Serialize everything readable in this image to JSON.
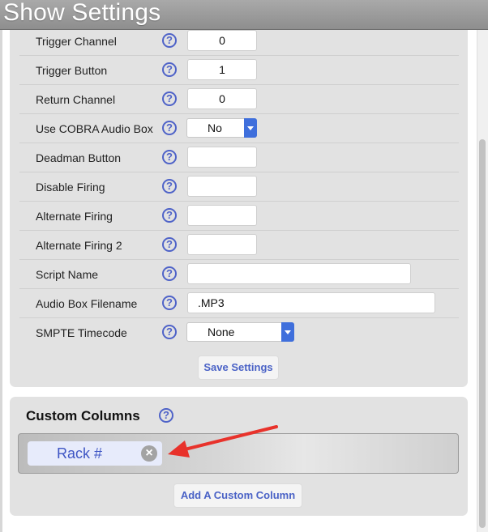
{
  "window": {
    "title": "Show Settings"
  },
  "settings": {
    "rows": [
      {
        "label": "Trigger Channel",
        "value": "0"
      },
      {
        "label": "Trigger Button",
        "value": "1"
      },
      {
        "label": "Return Channel",
        "value": "0"
      },
      {
        "label": "Use COBRA Audio Box",
        "value": "No"
      },
      {
        "label": "Deadman Button",
        "value": ""
      },
      {
        "label": "Disable Firing",
        "value": ""
      },
      {
        "label": "Alternate Firing",
        "value": ""
      },
      {
        "label": "Alternate Firing 2",
        "value": ""
      },
      {
        "label": "Script Name",
        "value": ""
      },
      {
        "label": "Audio Box Filename",
        "value": ".MP3"
      },
      {
        "label": "SMPTE Timecode",
        "value": "None"
      }
    ],
    "save_label": "Save Settings"
  },
  "custom_columns": {
    "title": "Custom Columns",
    "tags": [
      {
        "label": "Rack #"
      }
    ],
    "add_label": "Add A Custom Column"
  },
  "help_glyph": "?",
  "remove_glyph": "×",
  "colors": {
    "accent": "#4a62c6",
    "annotation_arrow": "#e8322b",
    "select_arrow": "#3f6fdc"
  }
}
